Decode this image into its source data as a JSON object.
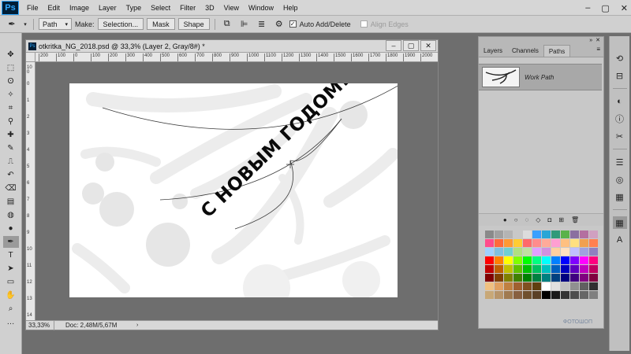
{
  "app": {
    "logo": "Ps",
    "menus": [
      "File",
      "Edit",
      "Image",
      "Layer",
      "Type",
      "Select",
      "Filter",
      "3D",
      "View",
      "Window",
      "Help"
    ],
    "window_controls": [
      "–",
      "▢",
      "✕"
    ]
  },
  "options": {
    "tool_mode": "Path",
    "make_label": "Make:",
    "selection_btn": "Selection...",
    "mask_btn": "Mask",
    "shape_btn": "Shape",
    "auto_add_delete": "Auto Add/Delete",
    "auto_add_delete_checked": true,
    "align_edges": "Align Edges",
    "align_edges_checked": false
  },
  "tools": [
    "move-icon",
    "marquee-icon",
    "lasso-icon",
    "magic-wand-icon",
    "crop-icon",
    "eyedropper-icon",
    "healing-icon",
    "brush-icon",
    "clone-stamp-icon",
    "history-brush-icon",
    "eraser-icon",
    "gradient-icon",
    "blur-icon",
    "dodge-icon",
    "pen-icon",
    "type-icon",
    "path-selection-icon",
    "rectangle-icon",
    "hand-icon",
    "zoom-icon",
    "more-icon"
  ],
  "document": {
    "title": "otkritka_NG_2018.psd @ 33,3% (Layer 2, Gray/8#) *",
    "zoom": "33,33%",
    "doc_info": "Doc: 2,48M/5,67M",
    "ruler_top": [
      "200",
      "100",
      "0",
      "100",
      "200",
      "300",
      "400",
      "500",
      "600",
      "700",
      "800",
      "900",
      "1000",
      "1100",
      "1200",
      "1300",
      "1400",
      "1500",
      "1600",
      "1700",
      "1800",
      "1900",
      "2000",
      "2100"
    ],
    "ruler_left": [
      "100",
      "0",
      "1",
      "2",
      "3",
      "4",
      "5",
      "6",
      "7",
      "8",
      "9",
      "10",
      "11",
      "12",
      "13",
      "14"
    ],
    "greeting": "С НОВЫМ ГОДОМ!"
  },
  "panel": {
    "tabs": [
      "Layers",
      "Channels",
      "Paths"
    ],
    "active_tab": "Paths",
    "path_name": "Work Path",
    "footer_icons": [
      "fill-path-icon",
      "stroke-path-icon",
      "load-selection-icon",
      "make-work-path-icon",
      "add-mask-icon",
      "new-path-icon",
      "delete-path-icon"
    ],
    "swatch_colors": [
      "#8a8a8a",
      "#a0a0a0",
      "#b4b4b4",
      "#c8c8c8",
      "#dcdcdc",
      "#3aa0ff",
      "#2aa6d6",
      "#2f9a7a",
      "#5bb24a",
      "#8b6fa0",
      "#b46fa0",
      "#d0a0c0",
      "#ff4c8c",
      "#ff6a3a",
      "#ff9933",
      "#ffcc33",
      "#ff6a6a",
      "#ff8c8c",
      "#ffaa9a",
      "#ff9fd2",
      "#ffc080",
      "#ffe080",
      "#f0a050",
      "#ff8050",
      "#a0d0ff",
      "#80c0e0",
      "#70d0d0",
      "#b0e080",
      "#c0e0a0",
      "#e0a0ff",
      "#d090e0",
      "#ffd0a0",
      "#ffe0c0",
      "#c0c0ff",
      "#a0a0e0",
      "#9080c0",
      "#ff0000",
      "#ff8000",
      "#ffff00",
      "#80ff00",
      "#00ff00",
      "#00ff80",
      "#00ffff",
      "#0080ff",
      "#0000ff",
      "#8000ff",
      "#ff00ff",
      "#ff0080",
      "#c00000",
      "#c06000",
      "#c0c000",
      "#60c000",
      "#00c000",
      "#00c060",
      "#00c0c0",
      "#0060c0",
      "#0000c0",
      "#6000c0",
      "#c000c0",
      "#c00060",
      "#800000",
      "#804000",
      "#808000",
      "#408000",
      "#008000",
      "#008040",
      "#008080",
      "#004080",
      "#000080",
      "#400080",
      "#800080",
      "#800040",
      "#f0c080",
      "#e0a060",
      "#c08040",
      "#a06030",
      "#805020",
      "#604010",
      "#ffffff",
      "#e0e0e0",
      "#c0c0c0",
      "#909090",
      "#606060",
      "#303030",
      "#c8a878",
      "#b8956a",
      "#a07a50",
      "#886040",
      "#70502e",
      "#5a4026",
      "#000000",
      "#1a1a1a",
      "#333333",
      "#4d4d4d",
      "#666666",
      "#7f7f7f"
    ],
    "watermark": "ФОТОШОП"
  },
  "strip": [
    "history-icon",
    "properties-icon",
    "adjustments-icon",
    "info-icon",
    "brushes-icon",
    "tools-preset-icon",
    "styles-icon",
    "libraries-icon",
    "swatches-icon",
    "character-icon"
  ]
}
